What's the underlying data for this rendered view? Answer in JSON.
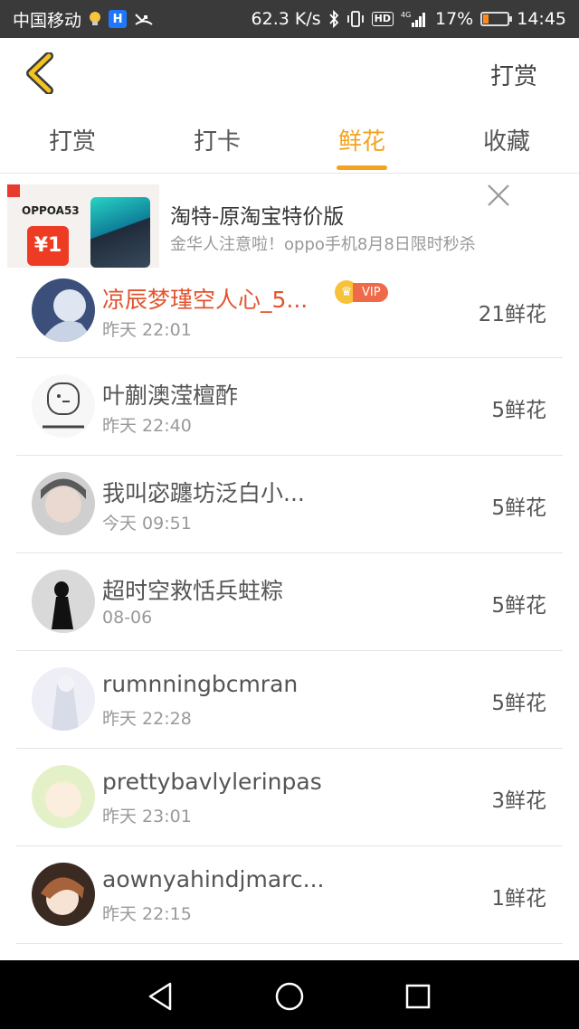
{
  "status_bar": {
    "carrier": "中国移动",
    "speed": "62.3 K/s",
    "hd": "HD",
    "network": "4G",
    "battery": "17%",
    "time": "14:45"
  },
  "header": {
    "right_action": "打赏"
  },
  "tabs": [
    {
      "label": "打赏",
      "active": false
    },
    {
      "label": "打卡",
      "active": false
    },
    {
      "label": "鲜花",
      "active": true
    },
    {
      "label": "收藏",
      "active": false
    }
  ],
  "ad": {
    "brand": "OPPOA53",
    "price": "¥1",
    "title": "淘特-原淘宝特价版",
    "subtitle": "金华人注意啦！oppo手机8月8日限时秒杀"
  },
  "list": [
    {
      "name": "凉辰梦瑾空人心_5...",
      "time": "昨天 22:01",
      "amount": "21鲜花",
      "vip": true,
      "vip_label": "VIP"
    },
    {
      "name": "叶蒯澳滢檀酢",
      "time": "昨天 22:40",
      "amount": "5鲜花",
      "vip": false
    },
    {
      "name": "我叫宓躔坊泛白小...",
      "time": "今天 09:51",
      "amount": "5鲜花",
      "vip": false
    },
    {
      "name": "超时空救恬兵蛀粽",
      "time": "08-06",
      "amount": "5鲜花",
      "vip": false
    },
    {
      "name": "rumnningbcmran",
      "time": "昨天 22:28",
      "amount": "5鲜花",
      "vip": false
    },
    {
      "name": "prettybavlylerinpas",
      "time": "昨天 23:01",
      "amount": "3鲜花",
      "vip": false
    },
    {
      "name": "aownyahindjmarc...",
      "time": "昨天 22:15",
      "amount": "1鲜花",
      "vip": false
    }
  ],
  "colors": {
    "accent": "#f3a320",
    "vip_name": "#e3532e",
    "status_bar": "#3a3a3a"
  }
}
